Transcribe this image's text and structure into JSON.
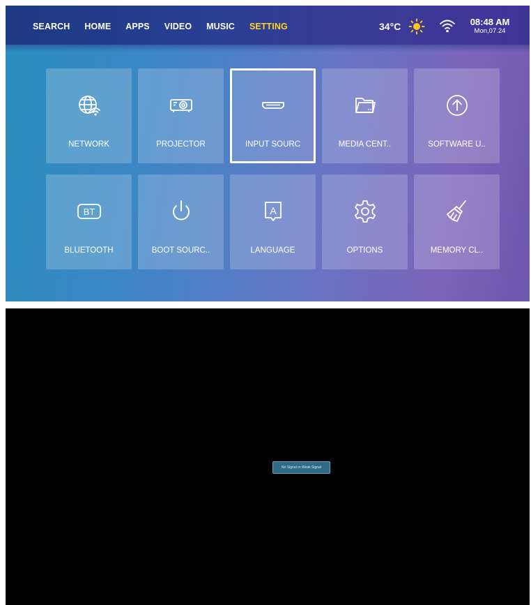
{
  "nav": {
    "items": [
      {
        "label": "SEARCH",
        "active": false
      },
      {
        "label": "HOME",
        "active": false
      },
      {
        "label": "APPS",
        "active": false
      },
      {
        "label": "VIDEO",
        "active": false
      },
      {
        "label": "MUSIC",
        "active": false
      },
      {
        "label": "SETTING",
        "active": true
      }
    ]
  },
  "status": {
    "temperature": "34°C",
    "weather_icon": "sun-icon",
    "network_icon": "wifi-icon",
    "time": "08:48 AM",
    "date": "Mon,07.24"
  },
  "tiles": [
    {
      "label": "NETWORK",
      "icon": "globe-wifi-icon"
    },
    {
      "label": "PROJECTOR",
      "icon": "projector-icon"
    },
    {
      "label": "INPUT SOURC",
      "icon": "hdmi-icon",
      "focused": true
    },
    {
      "label": "MEDIA CENT..",
      "icon": "folder-icon"
    },
    {
      "label": "SOFTWARE U..",
      "icon": "upload-arrow-icon"
    },
    {
      "label": "BLUETOOTH",
      "icon": "bluetooth-bt-icon"
    },
    {
      "label": "BOOT SOURC..",
      "icon": "power-icon"
    },
    {
      "label": "LANGUAGE",
      "icon": "language-a-icon"
    },
    {
      "label": "OPTIONS",
      "icon": "gear-icon"
    },
    {
      "label": "MEMORY CL..",
      "icon": "broom-icon"
    }
  ],
  "no_signal": {
    "message": "No Signal or Weak Signal"
  },
  "colors": {
    "active_nav": "#ffd21f",
    "sun": "#ffc61a",
    "signal_box": "#2f6b86"
  }
}
